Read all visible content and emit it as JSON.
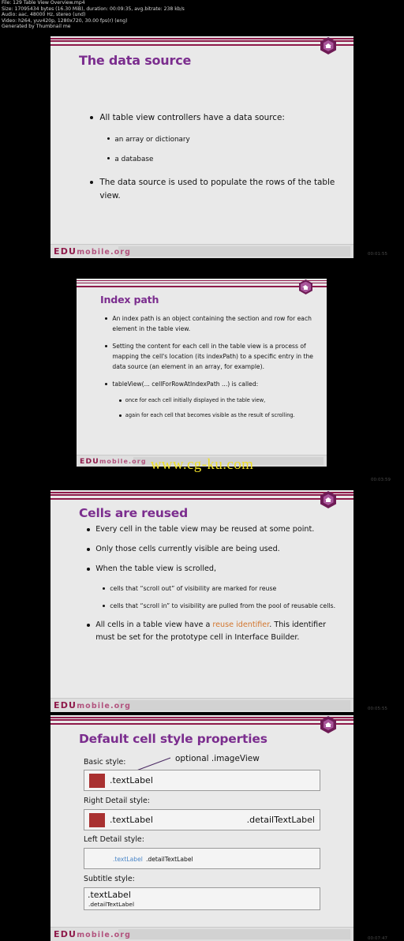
{
  "file_info": {
    "lines": [
      "File: 129  Table View Overview.mp4",
      "Size: 17095434 bytes (16.30 MiB), duration: 00:09:35, avg.bitrate: 238 kb/s",
      "Audio: aac, 48000 Hz, stereo (und)",
      "Video: h264, yuv420p, 1280x720, 30.00 fps(r) (eng)",
      "Generated by Thumbnail me"
    ]
  },
  "watermark": "www.cg-ku.com",
  "brand": {
    "edu": "EDU",
    "mobile": "mobile.org",
    "accent": "#8e1a4a",
    "title_color": "#7b2d8e",
    "highlight_color": "#d2762e"
  },
  "slides": [
    {
      "title": "The data source",
      "timestamp": "00:01:55",
      "bullets": [
        {
          "level": 1,
          "text": "All table view controllers have a data source:"
        },
        {
          "level": 2,
          "text": "an array or dictionary"
        },
        {
          "level": 2,
          "text": "a database"
        },
        {
          "level": 1,
          "text": "The data source is used to populate the rows of the table view."
        }
      ]
    },
    {
      "title": "Index path",
      "timestamp": "00:03:59",
      "bullets": [
        {
          "level": 1,
          "text": "An index path is an object containing the section and row for each element in the table view."
        },
        {
          "level": 1,
          "text": "Setting the content for each cell in the table view is a process of mapping the cell's location (its indexPath) to a specific entry in the data source (an element in an array, for example)."
        },
        {
          "level": 1,
          "text": "tableView(... cellForRowAtIndexPath ...) is called:"
        },
        {
          "level": 2,
          "text": "once for each cell initially displayed in the table view,"
        },
        {
          "level": 2,
          "text": "again for each cell that becomes visible as the result of scrolling."
        }
      ]
    },
    {
      "title": "Cells are reused",
      "timestamp": "00:05:55",
      "bullets": [
        {
          "level": 1,
          "text": "Every cell in the table view may be reused at some point."
        },
        {
          "level": 1,
          "text": "Only those cells currently visible are being used."
        },
        {
          "level": 1,
          "text": "When the table view is scrolled,"
        },
        {
          "level": 2,
          "text": "cells that “scroll out” of visibility are marked for reuse"
        },
        {
          "level": 2,
          "text": "cells that “scroll in” to visibility are pulled from the pool of reusable cells."
        },
        {
          "level": 1,
          "text_pre": "All cells in a table view have a ",
          "highlight": "reuse identifier",
          "text_post": ". This identifier must be set for the prototype cell in Interface Builder."
        }
      ]
    },
    {
      "title": "Default cell style properties",
      "timestamp": "00:07:47",
      "annotation": "optional .imageView",
      "styles": [
        {
          "label": "Basic style:",
          "text_label": ".textLabel",
          "detail_label": "",
          "swatch": true
        },
        {
          "label": "Right Detail style:",
          "text_label": ".textLabel",
          "detail_label": ".detailTextLabel",
          "swatch": true
        },
        {
          "label": "Left Detail style:",
          "text_label": ".textLabel",
          "detail_label": ".detailTextLabel",
          "swatch": false
        },
        {
          "label": "Subtitle style:",
          "text_label": ".textLabel",
          "detail_label": ".detailTextLabel",
          "swatch": false
        }
      ]
    }
  ]
}
